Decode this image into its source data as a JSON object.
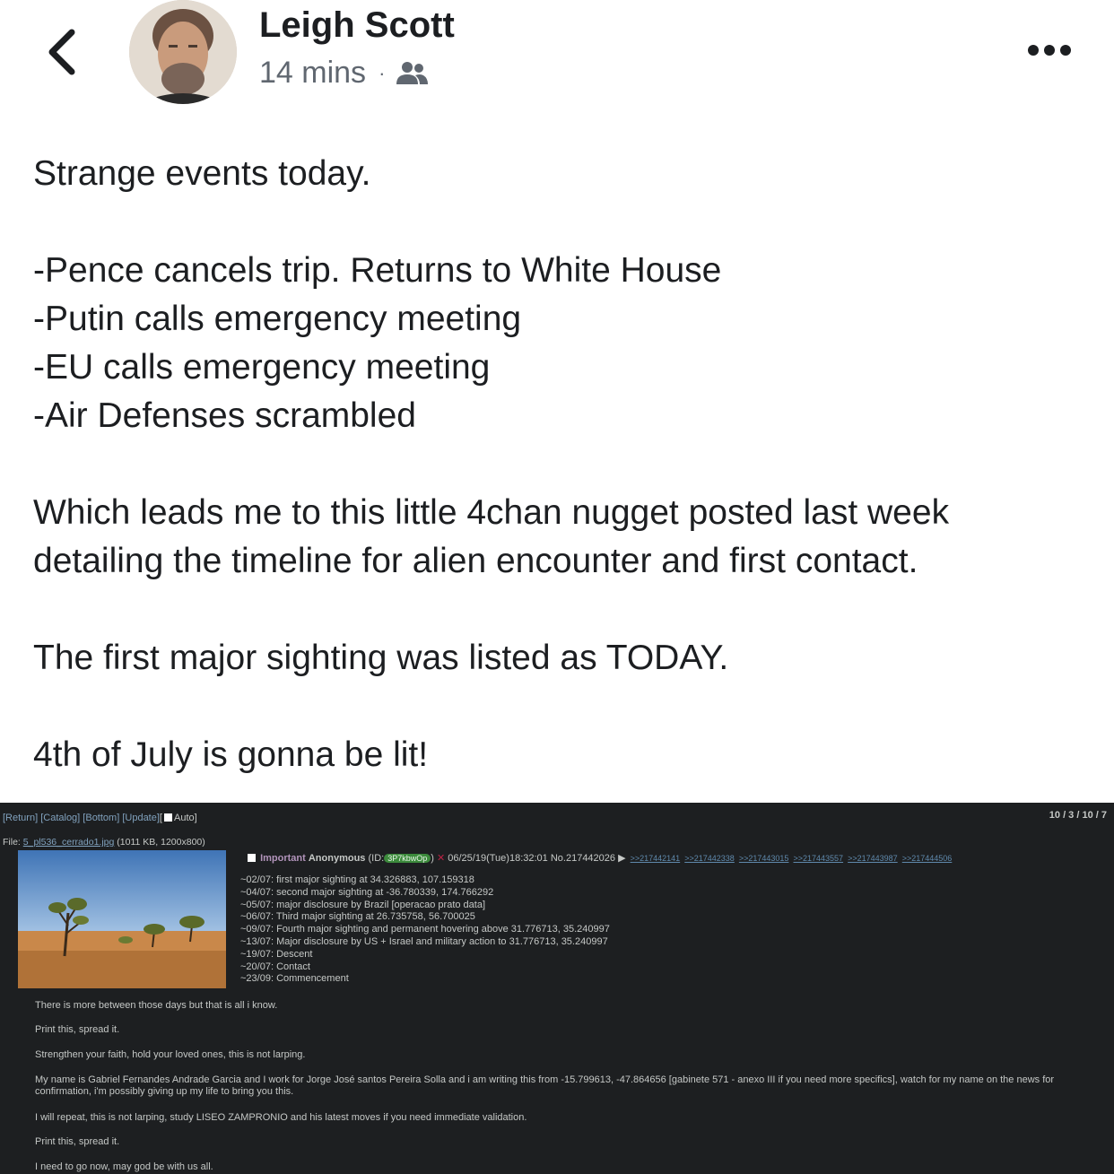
{
  "header": {
    "author_name": "Leigh Scott",
    "timestamp": "14 mins",
    "separator": "·",
    "audience_icon": "friends-icon",
    "back_icon": "chevron-left-icon",
    "more_icon": "more-dots-icon"
  },
  "post": {
    "intro": "Strange events today.",
    "events": [
      "-Pence cancels trip. Returns to White House",
      "-Putin calls emergency meeting",
      "-EU calls emergency meeting",
      "-Air Defenses scrambled"
    ],
    "para2_line1": "Which leads me to this little 4chan nugget posted last week",
    "para2_line2": "detailing the timeline for alien encounter and first contact.",
    "para3": "The first major sighting was listed as TODAY.",
    "para4": "4th of July is gonna be lit!"
  },
  "screenshot": {
    "nav": {
      "return": "[Return]",
      "catalog": "[Catalog]",
      "bottom": "[Bottom]",
      "update": "[Update]",
      "auto_open": "[",
      "auto": "Auto]"
    },
    "counts": "10 / 3 / 10 / 7",
    "file_label": "File:",
    "file_name": "5_pl536_cerrado1.jpg",
    "file_meta": "(1011 KB, 1200x800)",
    "subject": "Important",
    "poster_name": "Anonymous",
    "id_open": "(ID:",
    "poster_id": "3P7kbwOp",
    "id_close": ")",
    "post_datetime": "06/25/19(Tue)18:32:01",
    "post_no": "No.217442026",
    "arrow": "▶",
    "replies": [
      ">>217442141",
      ">>217442338",
      ">>217443015",
      ">>217443557",
      ">>217443987",
      ">>217444506"
    ],
    "timeline": [
      "~02/07: first major sighting at 34.326883, 107.159318",
      "~04/07: second major sighting at -36.780339, 174.766292",
      "~05/07: major disclosure by Brazil [operacao prato data]",
      "~06/07: Third major sighting at 26.735758, 56.700025",
      "~09/07: Fourth major sighting and permanent hovering above 31.776713, 35.240997",
      "~13/07: Major disclosure by US + Israel and military action to 31.776713, 35.240997",
      "~19/07: Descent",
      "~20/07: Contact",
      "~23/09: Commencement"
    ],
    "body": [
      "There is more between those days but that is all i know.",
      "Print this, spread it.",
      "Strengthen your faith, hold your loved ones, this is not larping.",
      "My name is Gabriel Fernandes Andrade Garcia and I work for Jorge José santos Pereira Solla and i am writing this from -15.799613, -47.864656 [gabinete 571 - anexo III if you need more specifics], watch for my name on the news for confirmation, i'm possibly giving up my life to bring you this.",
      "I will repeat, this is not larping, study LISEO ZAMPRONIO and his latest moves if you need immediate validation.",
      "Print this, spread it.",
      "I need to go now, may god be with us all."
    ]
  }
}
